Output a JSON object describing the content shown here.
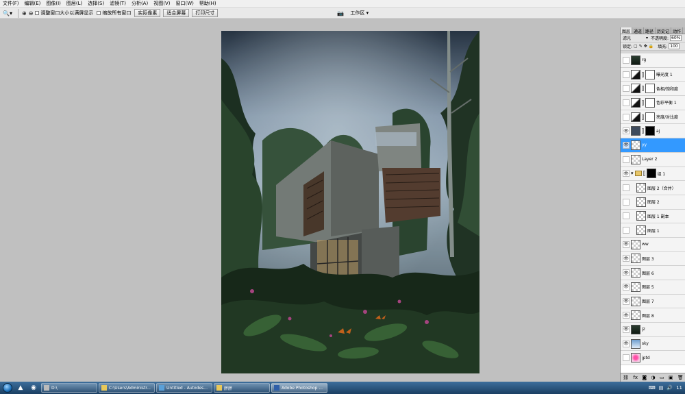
{
  "menu": [
    "文件(F)",
    "编辑(E)",
    "图像(I)",
    "图层(L)",
    "选择(S)",
    "滤镜(T)",
    "分析(A)",
    "视图(V)",
    "窗口(W)",
    "帮助(H)"
  ],
  "options": {
    "fit_window_label": "调整窗口大小以满屏显示",
    "zoom_all_label": "缩放所有窗口",
    "actual_pixels": "实际像素",
    "fit_screen": "适合屏幕",
    "print_size": "打印尺寸",
    "workspace": "工作区 ▾"
  },
  "layers_panel": {
    "tabs": [
      "图层",
      "通道",
      "路径",
      "历史记",
      "动作"
    ],
    "blend_mode": "滤光",
    "opacity_label": "不透明度:",
    "opacity_value": "60%",
    "lock_label": "锁定:",
    "fill_label": "填充:",
    "fill_value": "100",
    "layers": [
      {
        "name": "rg",
        "thumb": "img",
        "visible": false
      },
      {
        "name": "曝光度 1",
        "thumb": "adj",
        "visible": false,
        "mask": true
      },
      {
        "name": "色相/饱和度",
        "thumb": "adj",
        "visible": false,
        "mask": true
      },
      {
        "name": "色彩平衡 1",
        "thumb": "adj",
        "visible": false,
        "mask": true
      },
      {
        "name": "亮度/对比度",
        "thumb": "adj",
        "visible": false,
        "mask": true
      },
      {
        "name": "aj",
        "thumb": "dark",
        "visible": true,
        "mask": true
      },
      {
        "name": "yy",
        "thumb": "trans",
        "visible": true,
        "selected": true
      },
      {
        "name": "Layer 2",
        "thumb": "trans",
        "visible": false
      },
      {
        "name": "组 1",
        "thumb": "folder",
        "visible": true,
        "group": true
      },
      {
        "name": "图层 2（合并）",
        "thumb": "trans",
        "visible": false,
        "indent": true
      },
      {
        "name": "图层 2",
        "thumb": "trans",
        "visible": false,
        "indent": true
      },
      {
        "name": "图层 1 副本",
        "thumb": "trans",
        "visible": false,
        "indent": true
      },
      {
        "name": "图层 1",
        "thumb": "trans",
        "visible": false,
        "indent": true
      },
      {
        "name": "ww",
        "thumb": "trans",
        "visible": true
      },
      {
        "name": "图层 3",
        "thumb": "trans",
        "visible": true
      },
      {
        "name": "图层 6",
        "thumb": "trans",
        "visible": true
      },
      {
        "name": "图层 5",
        "thumb": "trans",
        "visible": true
      },
      {
        "name": "图层 7",
        "thumb": "trans",
        "visible": true
      },
      {
        "name": "图层 8",
        "thumb": "trans",
        "visible": true
      },
      {
        "name": "jz",
        "thumb": "img",
        "visible": true
      },
      {
        "name": "sky",
        "thumb": "sky",
        "visible": true
      },
      {
        "name": "jptd",
        "thumb": "pink",
        "visible": false
      }
    ]
  },
  "taskbar": {
    "items": [
      {
        "label": "D:\\",
        "active": false
      },
      {
        "label": "C:\\Users\\Administr...",
        "active": false
      },
      {
        "label": "Untitled - Autodes...",
        "active": false
      },
      {
        "label": "胖胖",
        "active": false
      },
      {
        "label": "Adobe Photoshop ...",
        "active": true
      }
    ],
    "clock": "11"
  }
}
